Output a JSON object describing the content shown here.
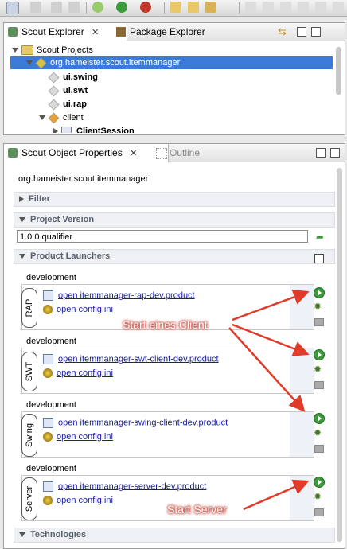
{
  "scout_explorer": {
    "tabs": [
      {
        "label": "Scout Explorer",
        "close": "✕"
      },
      {
        "label": "Package Explorer"
      }
    ],
    "tree": [
      {
        "label": "Scout Projects"
      },
      {
        "label": "org.hameister.scout.itemmanager"
      },
      {
        "label": "ui.swing"
      },
      {
        "label": "ui.swt"
      },
      {
        "label": "ui.rap"
      },
      {
        "label": "client"
      },
      {
        "label": "ClientSession"
      }
    ]
  },
  "properties": {
    "tabs": [
      {
        "label": "Scout Object Properties",
        "close": "✕"
      },
      {
        "label": "Outline"
      }
    ],
    "project_name": "org.hameister.scout.itemmanager",
    "sections": {
      "filter": "Filter",
      "project_version": "Project Version",
      "product_launchers": "Product Launchers",
      "technologies": "Technologies"
    },
    "version_value": "1.0.0.qualifier",
    "launchers": [
      {
        "group": "development",
        "label": "RAP",
        "product": "open itemmanager-rap-dev.product",
        "config": "open config.ini"
      },
      {
        "group": "development",
        "label": "SWT",
        "product": "open itemmanager-swt-client-dev.product",
        "config": "open config.ini"
      },
      {
        "group": "development",
        "label": "Swing",
        "product": "open itemmanager-swing-client-dev.product",
        "config": "open config.ini"
      },
      {
        "group": "development",
        "label": "Server",
        "product": "open itemmanager-server-dev.product",
        "config": "open config.ini"
      }
    ]
  },
  "annotations": {
    "client": "Start eines Client",
    "server": "Start Server",
    "color": "#e03a28"
  }
}
